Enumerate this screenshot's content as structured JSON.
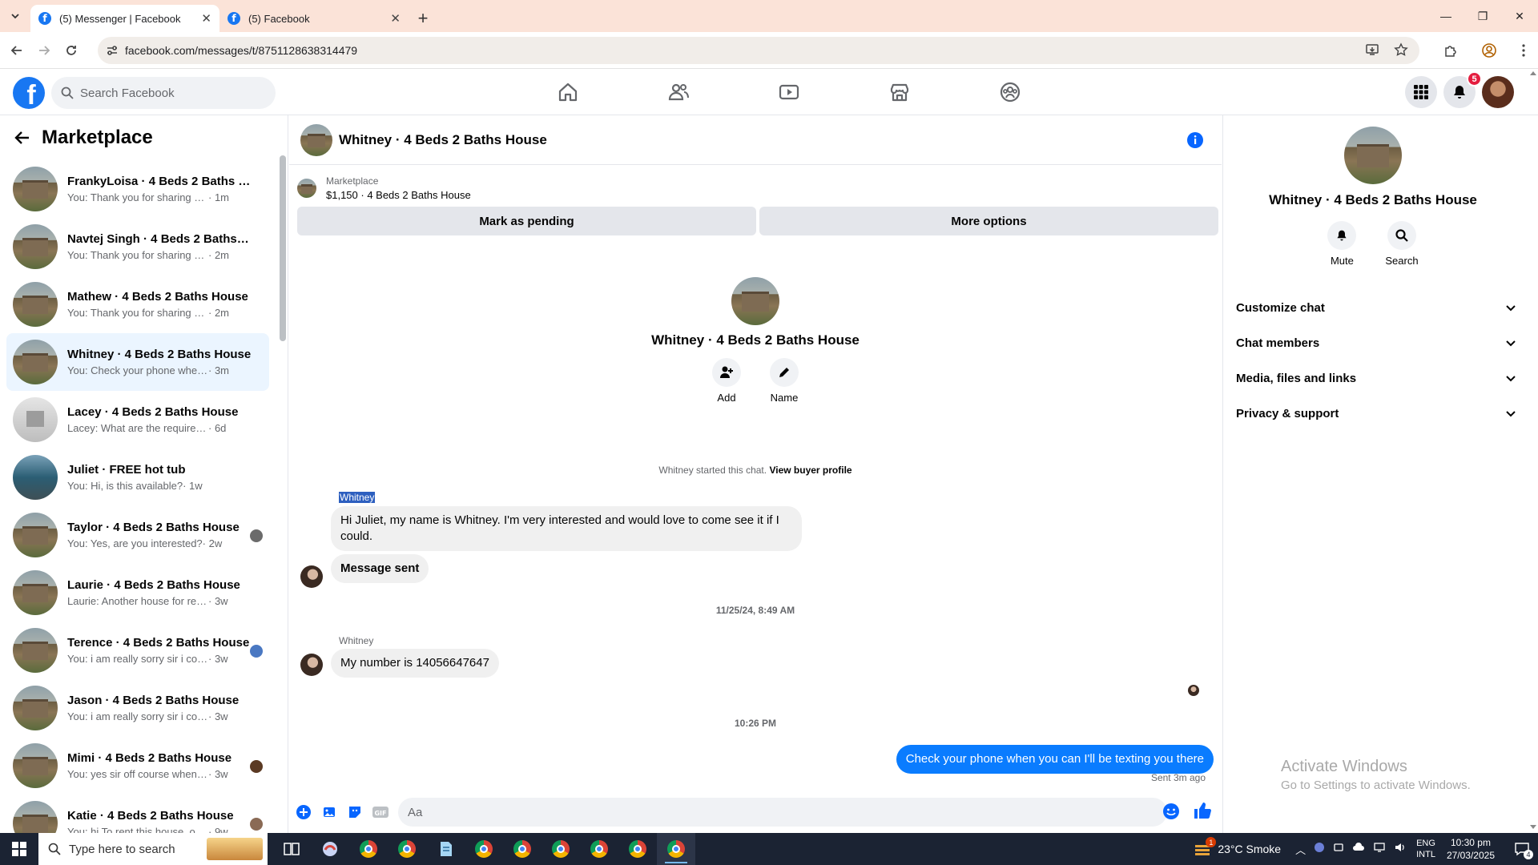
{
  "browser": {
    "tabs": [
      {
        "title": "(5) Messenger | Facebook",
        "active": true
      },
      {
        "title": "(5) Facebook",
        "active": false
      }
    ],
    "url": "facebook.com/messages/t/8751128638314479"
  },
  "facebook": {
    "search_placeholder": "Search Facebook",
    "notification_count": "5"
  },
  "sidebar": {
    "title": "Marketplace",
    "conversations": [
      {
        "name": "FrankyLoisa · 4 Beds 2 Baths Ho...",
        "preview": "You: Thank you for sharing your n...",
        "time": "· 1m"
      },
      {
        "name": "Navtej Singh · 4 Beds 2 Baths H...",
        "preview": "You: Thank you for sharing your n...",
        "time": "· 2m"
      },
      {
        "name": "Mathew · 4 Beds 2 Baths House",
        "preview": "You: Thank you for sharing your n...",
        "time": "· 2m"
      },
      {
        "name": "Whitney · 4 Beds 2 Baths House",
        "preview": "You: Check your phone when you ...",
        "time": "· 3m"
      },
      {
        "name": "Lacey · 4 Beds 2 Baths House",
        "preview": "Lacey: What are the requirements t...",
        "time": "· 6d"
      },
      {
        "name": "Juliet · FREE hot tub",
        "preview": "You: Hi, is this available?",
        "time": "· 1w"
      },
      {
        "name": "Taylor · 4 Beds 2 Baths House",
        "preview": "You: Yes, are you interested?",
        "time": "· 2w"
      },
      {
        "name": "Laurie · 4 Beds 2 Baths House",
        "preview": "Laurie: Another house for rent in T...",
        "time": "· 3w"
      },
      {
        "name": "Terence · 4 Beds 2 Baths House",
        "preview": "You: i am really sorry sir i couldn...",
        "time": "· 3w"
      },
      {
        "name": "Jason · 4 Beds 2 Baths House",
        "preview": "You: i am really sorry sir i couldn't r...",
        "time": "· 3w"
      },
      {
        "name": "Mimi · 4 Beds 2 Baths House",
        "preview": "You: yes sir off course when are ...",
        "time": "· 3w"
      },
      {
        "name": "Katie · 4 Beds 2 Baths House",
        "preview": "You: hi To rent this house, our a...",
        "time": "· 9w"
      }
    ]
  },
  "chat": {
    "title": "Whitney · 4 Beds 2 Baths House",
    "listing_source": "Marketplace",
    "listing_detail": "$1,150 · 4 Beds 2 Baths House",
    "mark_pending_label": "Mark as pending",
    "more_options_label": "More options",
    "profile_name": "Whitney · 4 Beds 2 Baths House",
    "add_label": "Add",
    "name_label": "Name",
    "started_text": "Whitney started this chat.",
    "view_profile_label": "View buyer profile",
    "messages": [
      {
        "sender": "Whitney",
        "text": "Hi Juliet, my name is Whitney. I'm very interested and would love to come see it if I could."
      },
      {
        "text": "Message sent"
      },
      {
        "sender": "Whitney",
        "text": "My number is 14056647647"
      }
    ],
    "date1": "11/25/24, 8:49 AM",
    "date2": "10:26 PM",
    "outgoing": "Check your phone when you can I'll be texting you there",
    "sent_status": "Sent 3m ago",
    "composer_placeholder": "Aa"
  },
  "details": {
    "name": "Whitney · 4 Beds 2 Baths House",
    "mute_label": "Mute",
    "search_label": "Search",
    "sections": [
      "Customize chat",
      "Chat members",
      "Media, files and links",
      "Privacy & support"
    ]
  },
  "watermark": {
    "line1": "Activate Windows",
    "line2": "Go to Settings to activate Windows."
  },
  "taskbar": {
    "search_placeholder": "Type here to search",
    "weather": "23°C  Smoke",
    "weather_badge": "1",
    "lang1": "ENG",
    "lang2": "INTL",
    "time": "10:30 pm",
    "date": "27/03/2025",
    "notif_count": "4"
  }
}
